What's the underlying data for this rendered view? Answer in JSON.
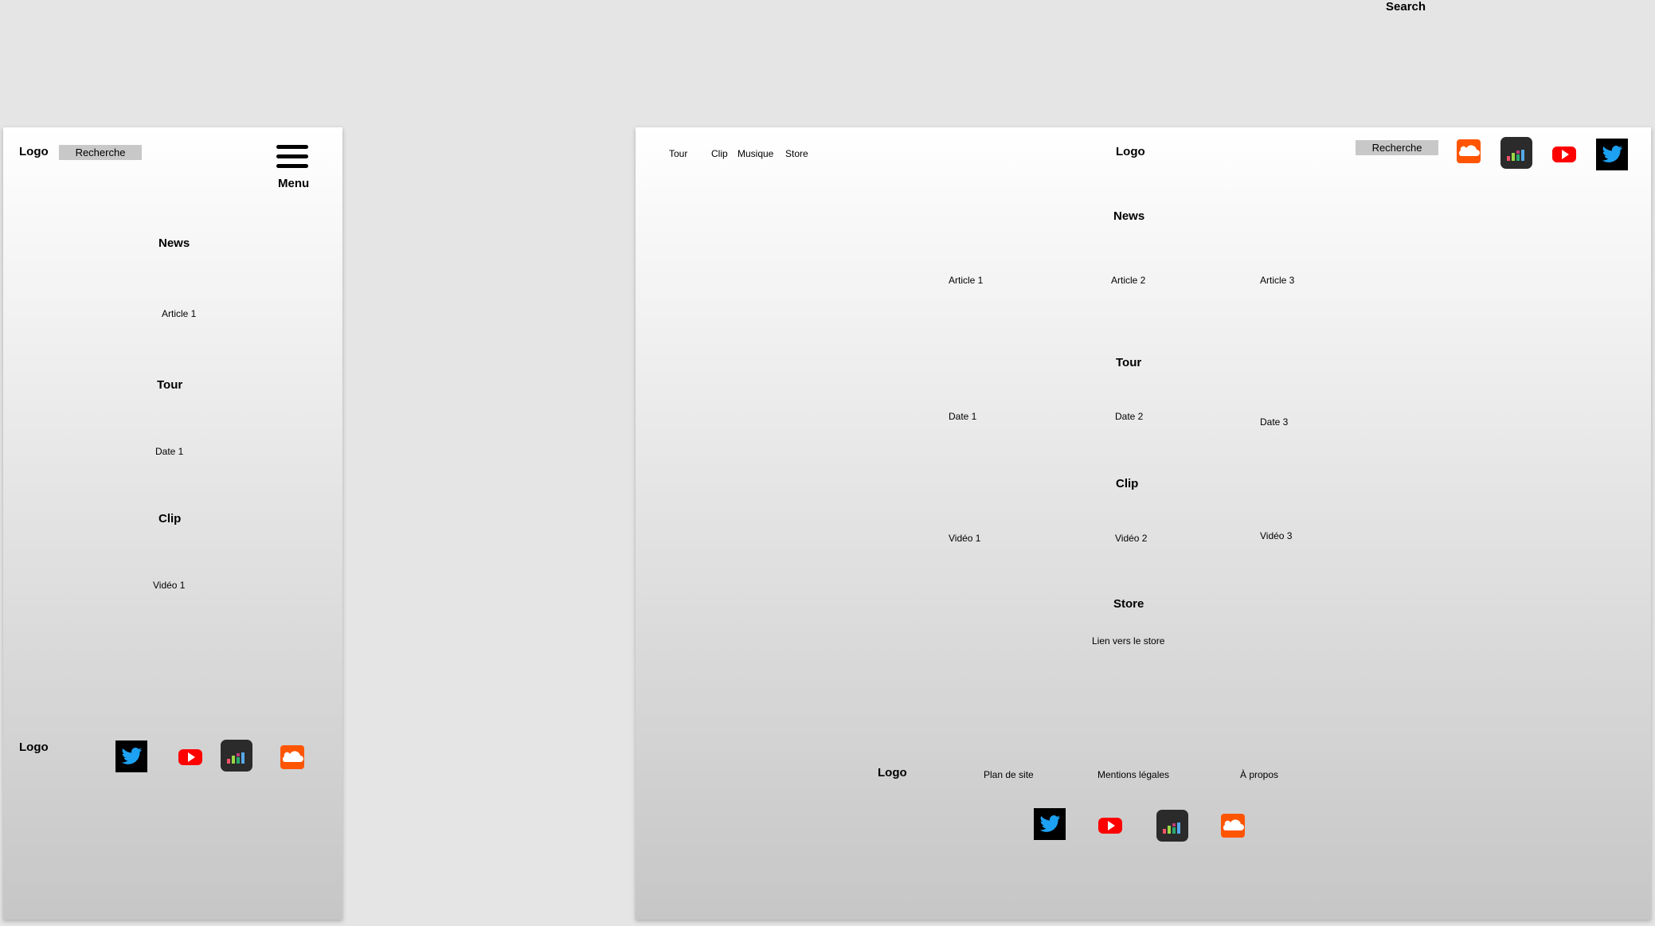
{
  "canvas_title": "Search",
  "mobile": {
    "header": {
      "logo": "Logo",
      "search_placeholder": "Recherche",
      "menu_label": "Menu"
    },
    "news": {
      "title": "News",
      "item": "Article 1"
    },
    "tour": {
      "title": "Tour",
      "item": "Date 1"
    },
    "clip": {
      "title": "Clip",
      "item": "Vidéo 1"
    },
    "footer": {
      "logo": "Logo"
    }
  },
  "desktop": {
    "nav": [
      "Tour",
      "Clip",
      "Musique",
      "Store"
    ],
    "logo": "Logo",
    "search_placeholder": "Recherche",
    "news": {
      "title": "News",
      "items": [
        "Article 1",
        "Article 2",
        "Article 3"
      ]
    },
    "tour": {
      "title": "Tour",
      "items": [
        "Date 1",
        "Date 2",
        "Date 3"
      ]
    },
    "clip": {
      "title": "Clip",
      "items": [
        "Vidéo 1",
        "Vidéo 2",
        "Vidéo 3"
      ]
    },
    "store": {
      "title": "Store",
      "link": "Lien vers le store"
    },
    "footer": {
      "logo": "Logo",
      "links": [
        "Plan de site",
        "Mentions légales",
        "À propos"
      ]
    }
  },
  "icons": {
    "twitter": "twitter-icon",
    "youtube": "youtube-icon",
    "deezer": "deezer-icon",
    "soundcloud": "soundcloud-icon"
  },
  "colors": {
    "twitter_bg": "#000000",
    "twitter_bird": "#1da1f2",
    "youtube": "#ff0000",
    "deezer_bg": "#2b2b2b",
    "soundcloud": "#ff5500",
    "search_box": "#c8c8c8"
  }
}
